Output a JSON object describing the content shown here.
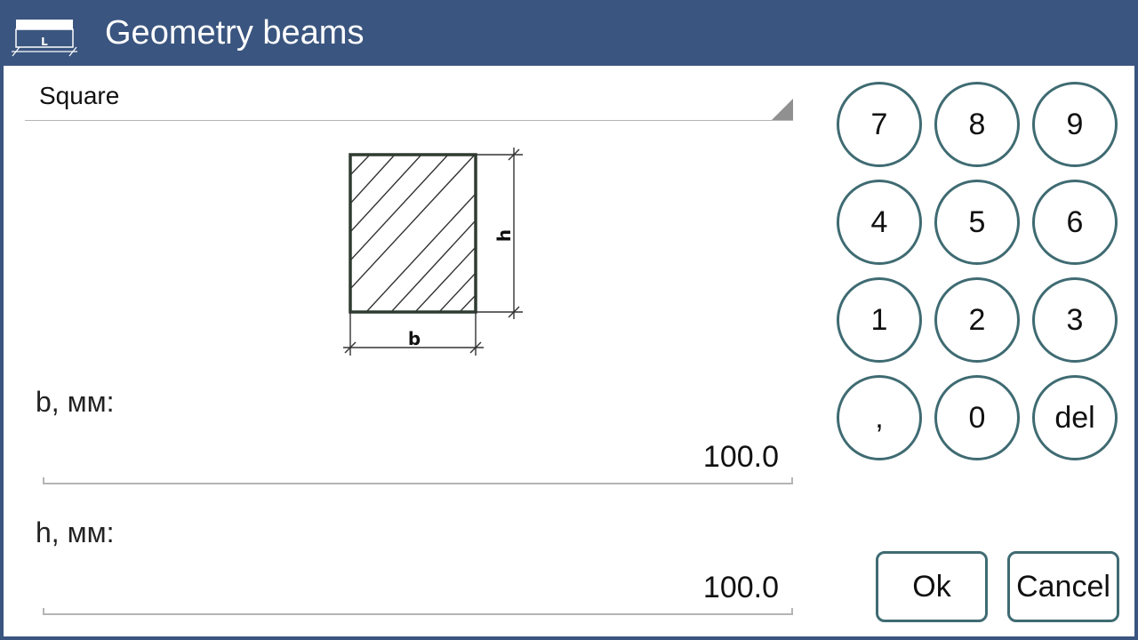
{
  "window": {
    "title": "Geometry beams",
    "icon_letter": "L"
  },
  "shape_select": {
    "value": "Square"
  },
  "diagram": {
    "width_symbol": "b",
    "height_symbol": "h"
  },
  "fields": {
    "b": {
      "label": "b, мм:",
      "value": "100.0"
    },
    "h": {
      "label": "h, мм:",
      "value": "100.0"
    }
  },
  "keypad": [
    "7",
    "8",
    "9",
    "4",
    "5",
    "6",
    "1",
    "2",
    "3",
    ",",
    "0",
    "del"
  ],
  "buttons": {
    "ok": "Ok",
    "cancel": "Cancel"
  },
  "colors": {
    "titlebar": "#3a557f",
    "button_border": "#3f6b72",
    "text": "#111111"
  }
}
